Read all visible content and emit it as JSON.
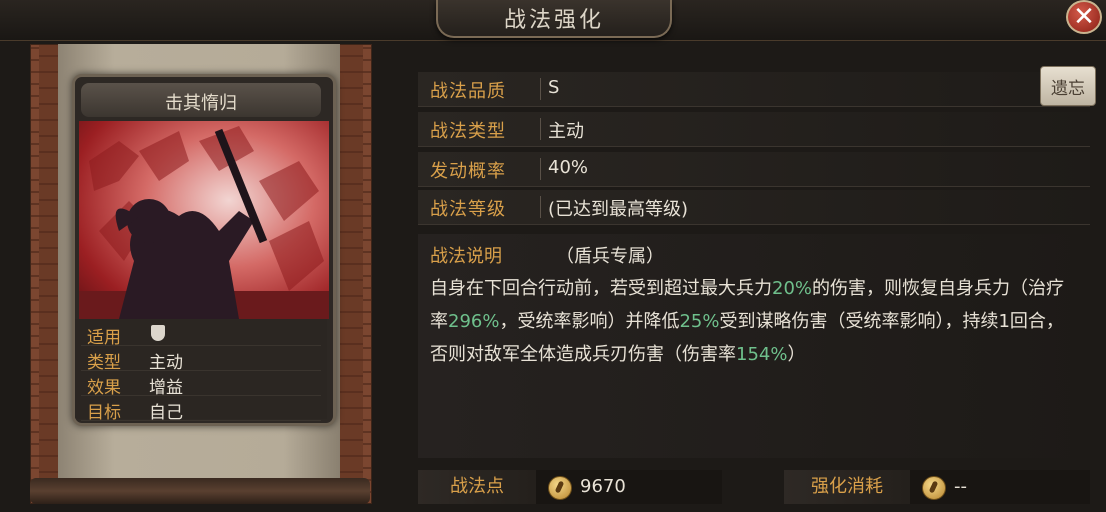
{
  "window": {
    "title": "战法强化",
    "close_icon": "close-icon"
  },
  "card": {
    "title": "击其惰归",
    "stats": [
      {
        "label": "适用",
        "value": "",
        "icon": "shield-icon"
      },
      {
        "label": "类型",
        "value": "主动"
      },
      {
        "label": "效果",
        "value": "增益"
      },
      {
        "label": "目标",
        "value": "自己"
      }
    ]
  },
  "info": {
    "quality_label": "战法品质",
    "quality_value": "S",
    "type_label": "战法类型",
    "type_value": "主动",
    "chance_label": "发动概率",
    "chance_value": "40%",
    "level_label": "战法等级",
    "level_value": "(已达到最高等级)",
    "upgrade_button": "遗忘"
  },
  "description": {
    "heading": "战法说明",
    "tag": "（盾兵专属）",
    "segments": [
      {
        "text": "自身在下回合行动前，若受到超过最大兵力",
        "hl": false
      },
      {
        "text": "20%",
        "hl": true
      },
      {
        "text": "的伤害，则恢复自身兵力（治疗率",
        "hl": false
      },
      {
        "text": "296%",
        "hl": true
      },
      {
        "text": "，受统率影响）并降低",
        "hl": false
      },
      {
        "text": "25%",
        "hl": true
      },
      {
        "text": "受到谋略伤害（受统率影响），持续1回合，否则对敌军全体造成兵刃伤害（伤害率",
        "hl": false
      },
      {
        "text": "154%",
        "hl": true
      },
      {
        "text": "）",
        "hl": false
      }
    ]
  },
  "bottom": {
    "points_label": "战法点",
    "points_value": "9670",
    "cost_label": "强化消耗",
    "cost_value": "--"
  },
  "colors": {
    "label_gold": "#d9a04a",
    "highlight_green": "#6fc08c",
    "text": "#e8e2d6"
  }
}
